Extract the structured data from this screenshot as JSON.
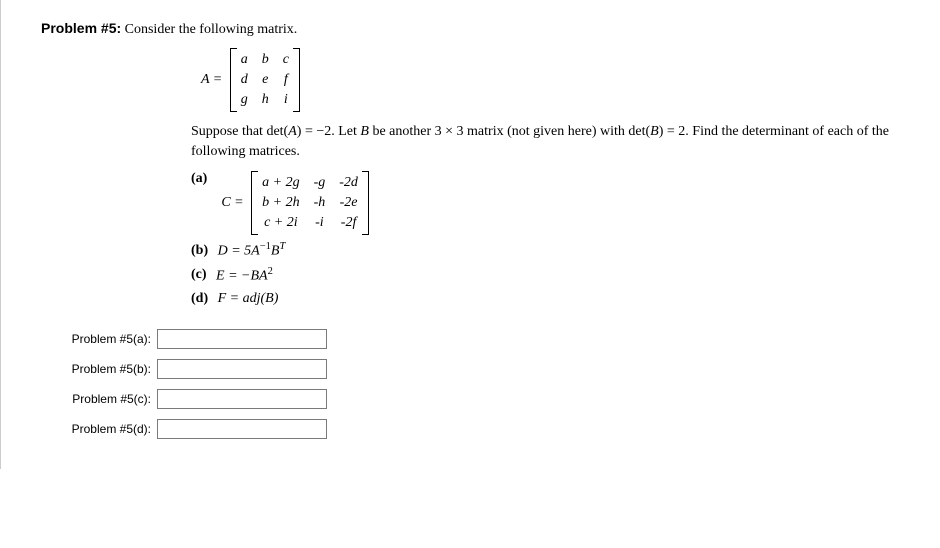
{
  "header": {
    "problem_label": "Problem #5:",
    "intro": "Consider the following matrix."
  },
  "matrixA": {
    "label": "A =",
    "cells": [
      "a",
      "b",
      "c",
      "d",
      "e",
      "f",
      "g",
      "h",
      "i"
    ]
  },
  "suppose_text_1": "Suppose that det(",
  "suppose_A": "A",
  "suppose_text_2": ") = −2. Let ",
  "suppose_B": "B",
  "suppose_text_3": " be another 3 × 3 matrix (not given here) with det(",
  "suppose_B2": "B",
  "suppose_text_4": ") = 2. Find the determinant of each of the following matrices.",
  "parts": {
    "a": {
      "label": "(a)",
      "matrix_label": "C =",
      "cells": [
        "a + 2g",
        "-g",
        "-2d",
        "b + 2h",
        "-h",
        "-2e",
        "c + 2i",
        "-i",
        "-2f"
      ]
    },
    "b": {
      "label": "(b)",
      "text_1": "D = 5A",
      "sup1": "−1",
      "text_2": "B",
      "sup2": "T"
    },
    "c": {
      "label": "(c)",
      "text_1": "E = −BA",
      "sup1": "2"
    },
    "d": {
      "label": "(d)",
      "text_1": "F = adj(B)"
    }
  },
  "answers": {
    "a": {
      "label": "Problem #5(a):"
    },
    "b": {
      "label": "Problem #5(b):"
    },
    "c": {
      "label": "Problem #5(c):"
    },
    "d": {
      "label": "Problem #5(d):"
    }
  }
}
